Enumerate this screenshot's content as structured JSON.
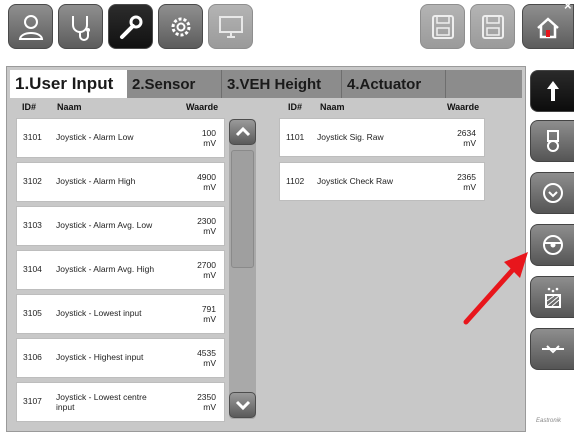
{
  "toolbar": {
    "left_buttons": [
      {
        "icon": "user-icon",
        "active": false
      },
      {
        "icon": "stethoscope-icon",
        "active": false
      },
      {
        "icon": "wrench-icon",
        "active": true
      },
      {
        "icon": "gear-icon",
        "active": false
      },
      {
        "icon": "monitor-icon",
        "active": false
      }
    ],
    "right_buttons": [
      {
        "icon": "save-all-icon"
      },
      {
        "icon": "save-icon"
      }
    ],
    "home_icon": "home-icon",
    "close_label": "×"
  },
  "tabs": [
    {
      "label": "1.User Input",
      "active": true
    },
    {
      "label": "2.Sensor",
      "active": false
    },
    {
      "label": "3.VEH Height",
      "active": false
    },
    {
      "label": "4.Actuator",
      "active": false
    }
  ],
  "columns": {
    "id": "ID#",
    "name": "Naam",
    "value": "Waarde"
  },
  "left_rows": [
    {
      "id": "3101",
      "name": "Joystick - Alarm Low",
      "value": "100",
      "unit": "mV"
    },
    {
      "id": "3102",
      "name": "Joystick - Alarm High",
      "value": "4900",
      "unit": "mV"
    },
    {
      "id": "3103",
      "name": "Joystick - Alarm Avg. Low",
      "value": "2300",
      "unit": "mV"
    },
    {
      "id": "3104",
      "name": "Joystick - Alarm Avg. High",
      "value": "2700",
      "unit": "mV"
    },
    {
      "id": "3105",
      "name": "Joystick - Lowest input",
      "value": "791",
      "unit": "mV"
    },
    {
      "id": "3106",
      "name": "Joystick - Highest input",
      "value": "4535",
      "unit": "mV"
    },
    {
      "id": "3107",
      "name": "Joystick - Lowest centre input",
      "value": "2350",
      "unit": "mV"
    }
  ],
  "right_rows": [
    {
      "id": "1101",
      "name": "Joystick Sig. Raw",
      "value": "2634",
      "unit": "mV"
    },
    {
      "id": "1102",
      "name": "Joystick Check Raw",
      "value": "2365",
      "unit": "mV"
    }
  ],
  "side_buttons": [
    {
      "icon": "arrow-up-icon"
    },
    {
      "icon": "sensor-icon"
    },
    {
      "icon": "gauge-icon"
    },
    {
      "icon": "steering-wheel-icon"
    },
    {
      "icon": "level-icon"
    },
    {
      "icon": "height-icon"
    }
  ],
  "footer_logo": "Eastronik",
  "colors": {
    "panel": "#c8c8c8",
    "tab_inactive": "#8c8c8c",
    "arrow": "#e8161c"
  }
}
